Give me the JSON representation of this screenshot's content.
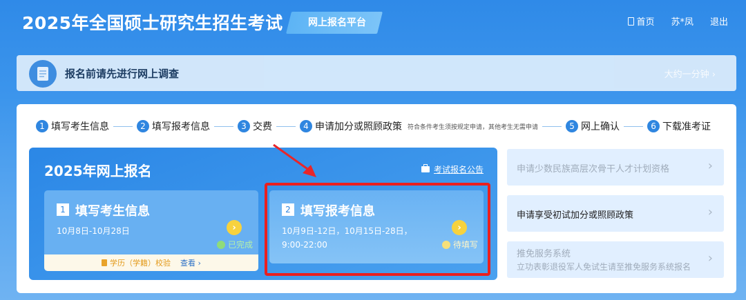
{
  "header": {
    "title": "2025年全国硕士研究生招生考试",
    "platform": "网上报名平台",
    "nav": [
      "首页",
      "苏*凤",
      "退出"
    ]
  },
  "survey": {
    "text": "报名前请先进行网上调查",
    "time": "大约一分钟 ›"
  },
  "steps": [
    {
      "num": "1",
      "label": "填写考生信息"
    },
    {
      "num": "2",
      "label": "填写报考信息"
    },
    {
      "num": "3",
      "label": "交费"
    },
    {
      "num": "4",
      "label": "申请加分或照顾政策",
      "note": "符合条件考生须按规定申请，其他考生无需申请"
    },
    {
      "num": "5",
      "label": "网上确认"
    },
    {
      "num": "6",
      "label": "下载准考证"
    }
  ],
  "registration": {
    "title": "2025年网上报名",
    "notice": "考试报名公告",
    "cards": [
      {
        "num": "1",
        "title": "填写考生信息",
        "date": "10月8日-10月28日",
        "status": "已完成",
        "verify_label": "学历（学籍）校验",
        "verify_view": "查看 ›"
      },
      {
        "num": "2",
        "title": "填写报考信息",
        "date_line1": "10月9日-12日，10月15日-28日，",
        "date_line2": "9:00-22:00",
        "status": "待填写"
      }
    ]
  },
  "side_items": [
    {
      "label": "申请少数民族高层次骨干人才计划资格"
    },
    {
      "label": "申请享受初试加分或照顾政策"
    },
    {
      "label": "推免服务系统",
      "sub": "立功表彰退役军人免试生请至推免服务系统报名"
    }
  ],
  "colors": {
    "header_bg": "#2f8ae8",
    "accent": "#2f86e0",
    "highlight": "#ea1f1f",
    "button": "#f7d23e"
  }
}
